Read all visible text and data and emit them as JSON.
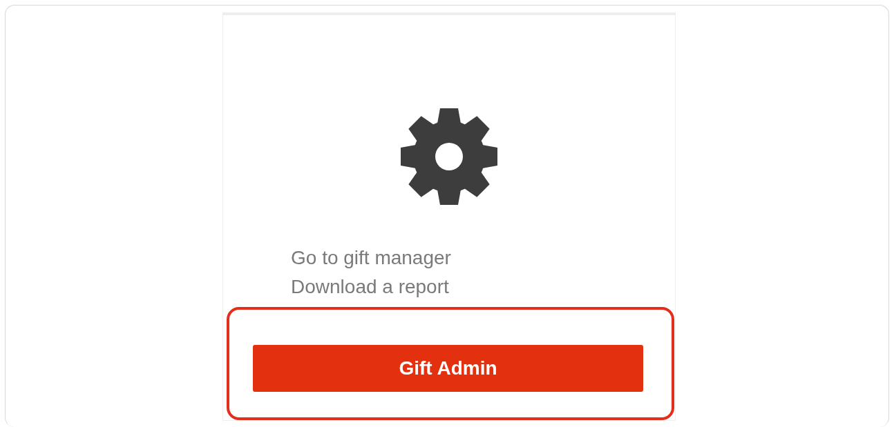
{
  "card": {
    "links": [
      "Go to gift manager",
      "Download a report"
    ],
    "action": {
      "label": "Gift Admin",
      "highlighted": true
    }
  }
}
